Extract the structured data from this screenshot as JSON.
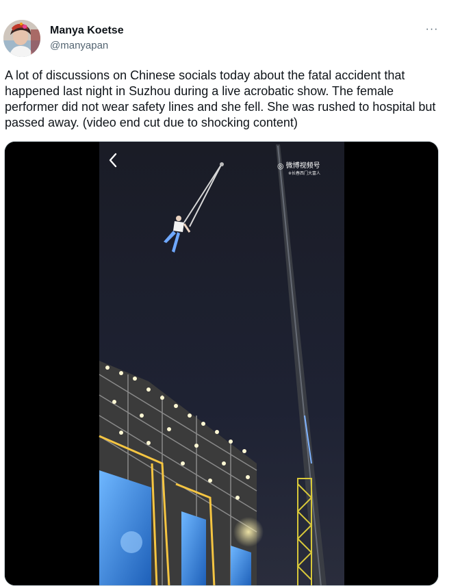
{
  "author": {
    "display_name": "Manya Koetse",
    "handle": "@manyapan"
  },
  "more_label": "···",
  "tweet": {
    "text": "A lot of discussions on Chinese socials today about the fatal accident that happened last night in Suzhou during a live acrobatic show. The female performer did not wear safety lines and she fell. She was rushed to hospital but passed away. (video end cut due to shocking content)"
  },
  "media": {
    "watermark_main": "微博视频号",
    "watermark_sub": "※长春西门大富人",
    "colors": {
      "night_sky": "#1c1f2e",
      "stage_lights": "#f5c542",
      "screen_blue": "#2e86de"
    }
  }
}
